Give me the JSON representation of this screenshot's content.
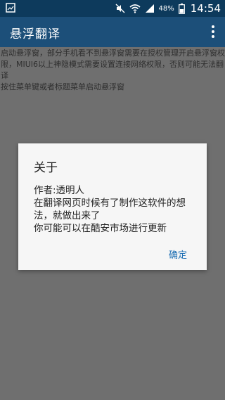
{
  "status_bar": {
    "battery_percent": "48%",
    "time": "14:54",
    "icons": [
      "image-notification-icon",
      "mute-icon",
      "wifi-icon",
      "signal-icon",
      "battery-icon"
    ]
  },
  "app_bar": {
    "title": "悬浮翻译",
    "overflow_icon": "more-vert-icon"
  },
  "content": {
    "lines": [
      "启动悬浮窗，部分手机看不到悬浮窗需要在授权管理开启悬浮窗权限，MIUI6以上神隐模式需要设置连接网络权限，否则可能无法翻译",
      "按住菜单键或者标题菜单启动悬浮窗"
    ]
  },
  "dialog": {
    "title": "关于",
    "message_lines": [
      "作者:透明人",
      "在翻译网页时候有了制作这软件的想法，就做出来了",
      "你可能可以在酷安市场进行更新"
    ],
    "ok_label": "确定"
  },
  "colors": {
    "status_bar": "#0d3a5c",
    "app_bar": "#1c4f79",
    "dim_background": "#6f6f6f",
    "dialog_bg": "#f6f6f6",
    "accent": "#1c6eb3"
  }
}
